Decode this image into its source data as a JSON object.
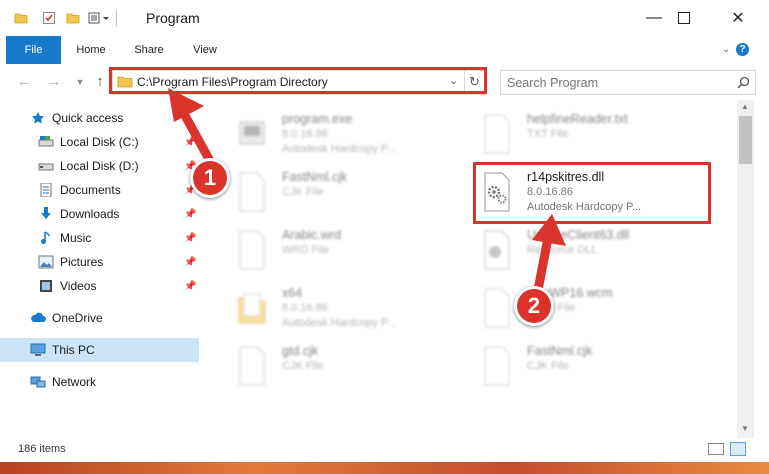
{
  "window": {
    "title": "Program"
  },
  "ribbon": {
    "tabs": [
      "File",
      "Home",
      "Share",
      "View"
    ]
  },
  "address_bar": {
    "path": "C:\\Program Files\\Program Directory"
  },
  "search": {
    "placeholder": "Search Program"
  },
  "navigation": {
    "quick_access": "Quick access",
    "items": [
      {
        "label": "Local Disk (C:)",
        "icon": "drive-icon",
        "pinned": true
      },
      {
        "label": "Local Disk (D:)",
        "icon": "drive-icon",
        "pinned": true
      },
      {
        "label": "Documents",
        "icon": "documents-icon",
        "pinned": true
      },
      {
        "label": "Downloads",
        "icon": "downloads-icon",
        "pinned": true
      },
      {
        "label": "Music",
        "icon": "music-icon",
        "pinned": true
      },
      {
        "label": "Pictures",
        "icon": "pictures-icon",
        "pinned": true
      },
      {
        "label": "Videos",
        "icon": "videos-icon",
        "pinned": true
      }
    ],
    "onedrive": "OneDrive",
    "this_pc": "This PC",
    "network": "Network"
  },
  "files": [
    {
      "name": "program.exe",
      "line2": "8.0.16.86",
      "line3": "Autodesk Hardcopy P...",
      "blurred": true,
      "icon": "exe-icon"
    },
    {
      "name": "helpfineReader.txt",
      "line2": "TXT File",
      "line3": "",
      "blurred": true,
      "icon": "document-icon"
    },
    {
      "name": "FastNml.cjk",
      "line2": "CJK File",
      "line3": "",
      "blurred": true,
      "icon": "document-icon"
    },
    {
      "name": "r14pskitres.dll",
      "line2": "8.0.16.86",
      "line3": "Autodesk Hardcopy P...",
      "blurred": false,
      "icon": "dll-gear-icon"
    },
    {
      "name": "Arabic.wrd",
      "line2": "WRD File",
      "line3": "",
      "blurred": true,
      "icon": "document-icon"
    },
    {
      "name": "UpdateClient63.dll",
      "line2": "Resource DLL",
      "line3": "",
      "blurred": true,
      "icon": "dll-gear-icon"
    },
    {
      "name": "x64",
      "line2": "8.0.16.86",
      "line3": "Autodesk Hardcopy P...",
      "blurred": true,
      "icon": "folder-icon"
    },
    {
      "name": "DocWP16.wcm",
      "line2": "WCM File",
      "line3": "",
      "blurred": true,
      "icon": "document-icon"
    },
    {
      "name": "gtd.cjk",
      "line2": "CJK File",
      "line3": "",
      "blurred": true,
      "icon": "document-icon"
    },
    {
      "name": "FastNml.cjk",
      "line2": "CJK File",
      "line3": "",
      "blurred": true,
      "icon": "document-icon"
    }
  ],
  "status": {
    "item_count": "186 items"
  },
  "annotations": {
    "step1": "1",
    "step2": "2"
  },
  "colors": {
    "accent": "#1979ca",
    "highlight": "#d9332c",
    "selected": "#cce4f7"
  }
}
